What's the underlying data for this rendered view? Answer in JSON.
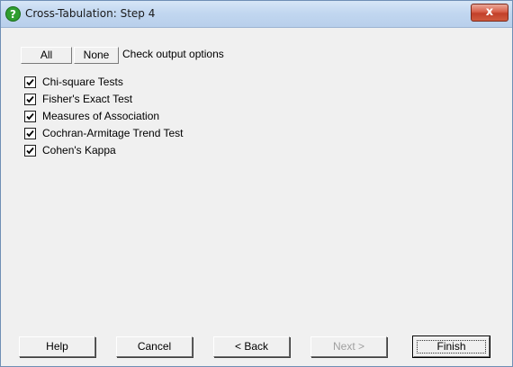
{
  "window": {
    "title": "Cross-Tabulation: Step 4",
    "close_label": "x"
  },
  "toolbar": {
    "all_label": "All",
    "none_label": "None",
    "hint": "Check output options"
  },
  "options": [
    {
      "label": "Chi-square Tests",
      "checked": true
    },
    {
      "label": "Fisher's Exact Test",
      "checked": true
    },
    {
      "label": "Measures of Association",
      "checked": true
    },
    {
      "label": "Cochran-Armitage Trend Test",
      "checked": true
    },
    {
      "label": "Cohen's Kappa",
      "checked": true
    }
  ],
  "footer": {
    "help": "Help",
    "cancel": "Cancel",
    "back": "< Back",
    "next": "Next >",
    "finish": "Finish"
  },
  "colors": {
    "title_icon": "#2f9e2f",
    "close_button": "#c8462e"
  }
}
